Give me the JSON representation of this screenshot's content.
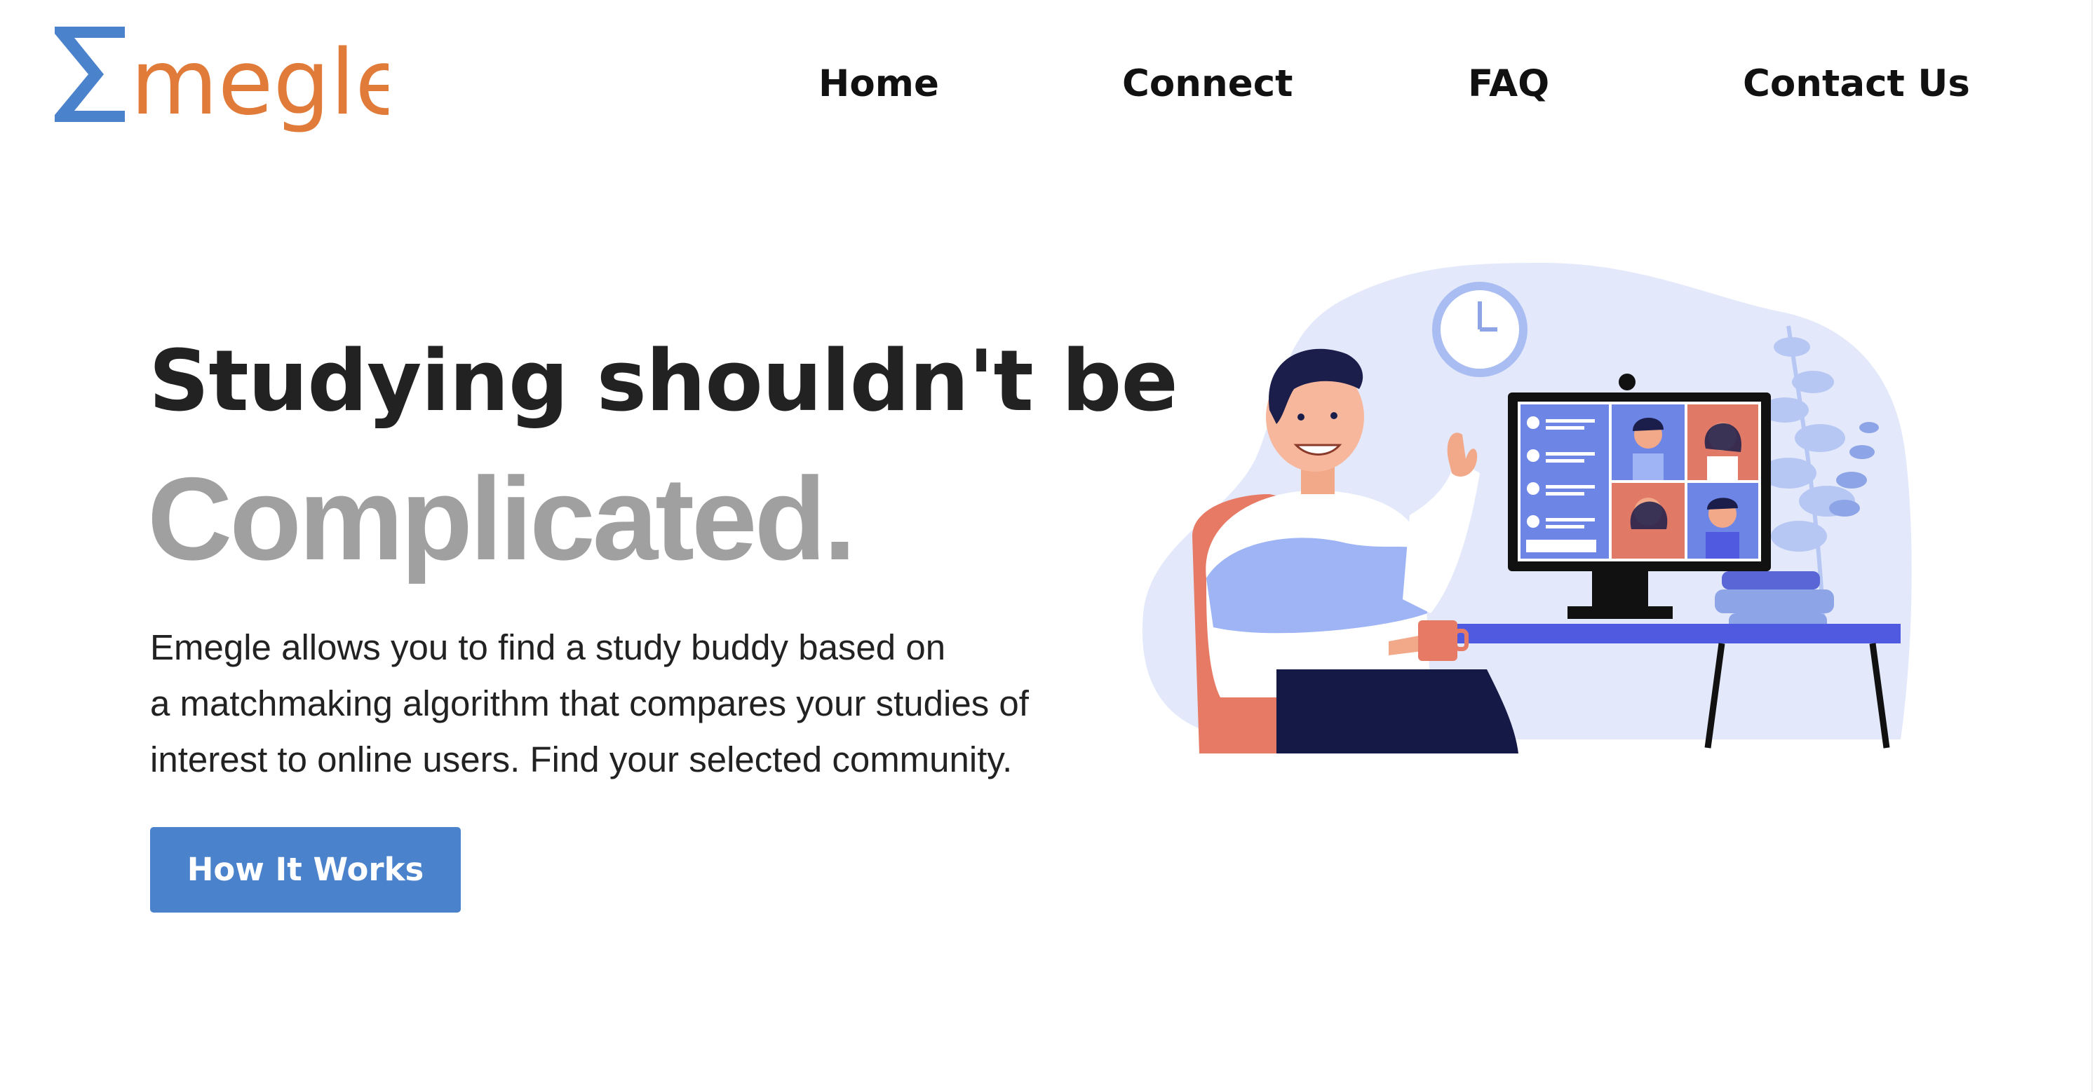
{
  "brand": {
    "logo_text": "megle",
    "logo_symbol": "Σ",
    "logo_symbol_color": "#4a82cc",
    "logo_text_color": "#e07b3a"
  },
  "nav": {
    "items": [
      {
        "label": "Home"
      },
      {
        "label": "Connect"
      },
      {
        "label": "FAQ"
      },
      {
        "label": "Contact Us"
      }
    ]
  },
  "hero": {
    "headline_line1": "Studying shouldn't be",
    "headline_line2": "Complicated.",
    "description_lines": [
      "Emegle allows you to find a study buddy based on",
      "a matchmaking algorithm that compares your studies of",
      "interest to online users. Find your selected community."
    ],
    "cta_label": "How It Works"
  },
  "colors": {
    "accent": "#4a82cc",
    "heading": "#222222",
    "heading_muted": "#a0a0a0",
    "illustration_bg": "#e3e9fb"
  },
  "illustration": {
    "icon": "video-call-illustration"
  }
}
